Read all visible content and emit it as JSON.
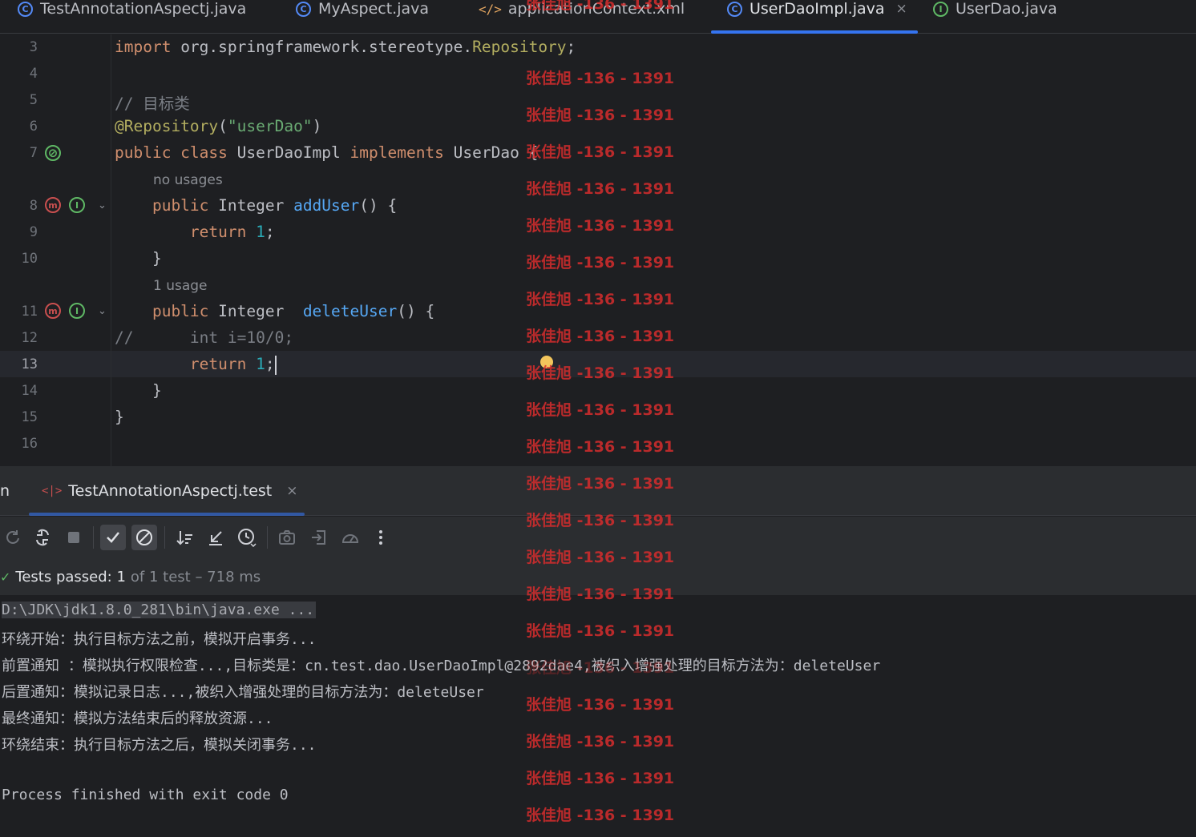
{
  "tabs": [
    {
      "label": "TestAnnotationAspectj.java",
      "icon": "class-icon",
      "active": false
    },
    {
      "label": "MyAspect.java",
      "icon": "class-icon",
      "active": false
    },
    {
      "label": "applicationContext.xml",
      "icon": "xml-icon",
      "active": false
    },
    {
      "label": "UserDaoImpl.java",
      "icon": "class-icon",
      "active": true
    },
    {
      "label": "UserDao.java",
      "icon": "interface-icon",
      "active": false
    }
  ],
  "tab_close_glyph": "×",
  "editor": {
    "line_numbers": [
      "3",
      "4",
      "5",
      "6",
      "7",
      "8",
      "9",
      "10",
      "11",
      "12",
      "13",
      "14",
      "15",
      "16"
    ],
    "current_line": "13",
    "hints": {
      "add_user": "no usages",
      "delete_user": "1 usage"
    },
    "code": {
      "l3_kw": "import",
      "l3_pkg": " org.springframework.stereotype.",
      "l3_cls": "Repository",
      "l3_end": ";",
      "l5": "// 目标类",
      "l6_ann": "@Repository",
      "l6_open": "(",
      "l6_str": "\"userDao\"",
      "l6_close": ")",
      "l7_kw1": "public class",
      "l7_name": " UserDaoImpl ",
      "l7_kw2": "implements",
      "l7_iface": " UserDao {",
      "l8_kw": "    public",
      "l8_type": " Integer ",
      "l8_fn": "addUser",
      "l8_end": "() {",
      "l9_kw": "        return",
      "l9_num": " 1",
      "l9_end": ";",
      "l10": "    }",
      "l11_kw": "    public",
      "l11_type": " Integer  ",
      "l11_fn": "deleteUser",
      "l11_end": "() {",
      "l12_cmt": "//",
      "l12_rest": "      int i=10/0;",
      "l13_kw": "        return",
      "l13_num": " 1",
      "l13_end": ";",
      "l14": "    }",
      "l15": "}"
    }
  },
  "run_panel": {
    "partial_label": "n",
    "tab_label": "TestAnnotationAspectj.test",
    "tab_close": "×",
    "toolbar": [
      "rerun-icon",
      "rerun-failed-icon",
      "stop-icon",
      "show-passed-icon",
      "show-ignored-icon",
      "sort-icon",
      "collapse-icon",
      "duration-icon",
      "screenshot-icon",
      "import-icon",
      "coverage-icon",
      "more-icon"
    ],
    "status": {
      "check": "✓",
      "passed": "Tests passed: 1",
      "detail": "of 1 test – 718 ms"
    },
    "console": [
      "D:\\JDK\\jdk1.8.0_281\\bin\\java.exe ...",
      "环绕开始：执行目标方法之前，模拟开启事务...",
      "前置通知 ：模拟执行权限检查...,目标类是：cn.test.dao.UserDaoImpl@2892dae4,被织入增强处理的目标方法为：deleteUser",
      "后置通知：模拟记录日志...,被织入增强处理的目标方法为：deleteUser",
      "最终通知：模拟方法结束后的释放资源...",
      "环绕结束：执行目标方法之后，模拟关闭事务...",
      "",
      "Process finished with exit code 0"
    ]
  },
  "watermark": {
    "text": "张佳旭 -136 - 1391"
  },
  "colors": {
    "accent": "#3574f0",
    "keyword": "#cf8e6d",
    "annotation": "#b3ae60",
    "string": "#6aab73",
    "number": "#2aacb8",
    "function": "#56a8f5",
    "watermark": "#d62d2d",
    "pass": "#5fb865"
  }
}
